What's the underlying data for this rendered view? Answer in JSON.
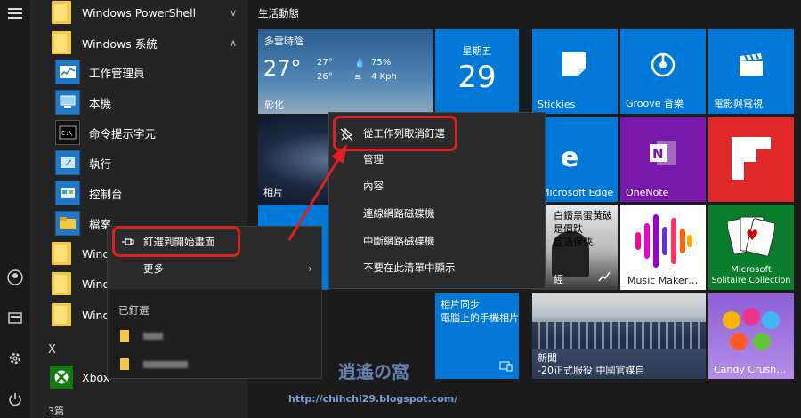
{
  "rail": {
    "icons": [
      "hamburger-icon",
      "user-icon",
      "documents-icon",
      "settings-icon",
      "power-icon"
    ]
  },
  "applist": {
    "rows": [
      {
        "label": "Windows PowerShell",
        "chevron": "∨"
      },
      {
        "label": "Windows 系統",
        "chevron": "∧"
      },
      {
        "label": "工作管理員"
      },
      {
        "label": "本機"
      },
      {
        "label": "命令提示字元"
      },
      {
        "label": "執行"
      },
      {
        "label": "控制台"
      },
      {
        "label": "檔案"
      },
      {
        "label": "Windo"
      },
      {
        "label": "Windo"
      },
      {
        "label": "Windo"
      },
      {
        "label": "X"
      },
      {
        "label": "Xbox"
      },
      {
        "label": "3篇"
      }
    ]
  },
  "ctx1": {
    "pin_start": "釘選到開始畫面",
    "more": "更多",
    "pinned_title": "已釘選"
  },
  "ctx2": {
    "unpin_taskbar": "從工作列取消釘選",
    "manage": "管理",
    "content": "內容",
    "connect_drive": "連線網路磁碟機",
    "disconnect_drive": "中斷網路磁碟機",
    "hide_list": "不要在此清單中顯示"
  },
  "tiles": {
    "group_title": "生活動態",
    "weather": {
      "condition": "多雲時陰",
      "temp": "27°",
      "high": "27°",
      "low": "26°",
      "humidity": "75%",
      "wind": "4 Kph",
      "city": "彰化"
    },
    "calendar": {
      "weekday": "星期五",
      "day": "29"
    },
    "photos_label": "相片",
    "stickies": "Stickies",
    "groove": "Groove 音樂",
    "movies": "電影與電視",
    "edge": "Microsoft Edge",
    "onenote": "OneNote",
    "news_headline_1": "白鑽黑蛋黃破",
    "news_headline_2": "是價跌",
    "news_headline_3": "超過保俠",
    "news_extra": "經",
    "music_maker": "Music Maker…",
    "solitaire_1": "Microsoft",
    "solitaire_2": "Solitaire Collection",
    "photo_sync_1": "相片同步",
    "photo_sync_2": "電腦上的手機相片",
    "news_bottom": "-20正式服役 中國官媒自",
    "news_bottom_label": "新聞",
    "candy": "Candy Crush…",
    "watermark": "http://chihchi29.blogspot.com/",
    "watermark_logo": "逍遙の窩"
  },
  "colors": {
    "accent": "#0078d7",
    "highlight": "#e02020",
    "onenote": "#7719aa",
    "flipboard": "#e12828"
  }
}
